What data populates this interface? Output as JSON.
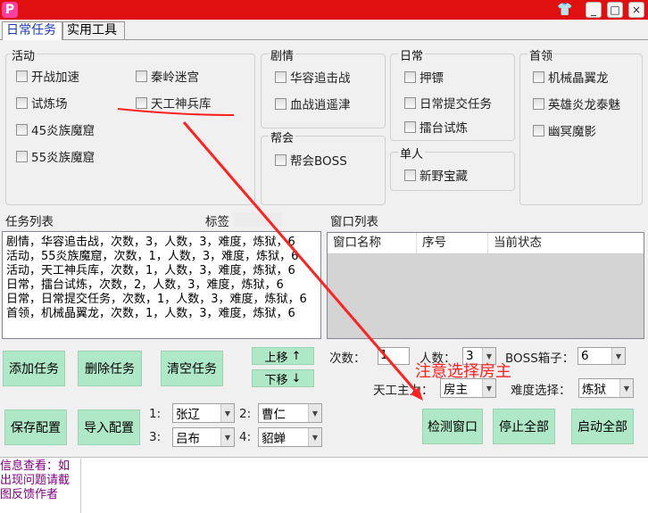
{
  "app": {
    "icon_letter": "P"
  },
  "window_controls": {
    "skin": "👕",
    "minimize": "_",
    "maximize": "□",
    "close": "×"
  },
  "tabs": [
    {
      "label": "日常任务"
    },
    {
      "label": "实用工具"
    }
  ],
  "groups": {
    "activity": {
      "title": "活动",
      "items": [
        "开战加速",
        "秦岭迷宫",
        "试炼场",
        "天工神兵库",
        "45炎族魔窟",
        "55炎族魔窟"
      ]
    },
    "story": {
      "title": "剧情",
      "items": [
        "华容追击战",
        "血战逍遥津"
      ]
    },
    "guild": {
      "title": "帮会",
      "items": [
        "帮会BOSS"
      ]
    },
    "daily": {
      "title": "日常",
      "items": [
        "押镖",
        "日常提交任务",
        "擂台试炼"
      ]
    },
    "solo": {
      "title": "单人",
      "items": [
        "新野宝藏"
      ]
    },
    "boss": {
      "title": "首领",
      "items": [
        "机械晶翼龙",
        "英雄炎龙泰魅",
        "幽冥魔影"
      ]
    }
  },
  "task_list": {
    "label": "任务列表",
    "tag_label": "标签",
    "lines": [
      "剧情，华容追击战，次数，3，人数，3，难度，炼狱，6",
      "活动，55炎族魔窟，次数，1，人数，3，难度，炼狱，6",
      "活动，天工神兵库，次数，1，人数，3，难度，炼狱，6",
      "日常，擂台试炼，次数，2，人数，3，难度，炼狱，6",
      "日常，日常提交任务，次数，1，人数，3，难度，炼狱，6",
      "首领，机械晶翼龙，次数，1，人数，3，难度，炼狱，6"
    ]
  },
  "window_list": {
    "label": "窗口列表",
    "columns": [
      "窗口名称",
      "序号",
      "当前状态"
    ]
  },
  "buttons": {
    "add_task": "添加任务",
    "delete_task": "删除任务",
    "clear_task": "清空任务",
    "move_up": "上移",
    "move_down": "下移",
    "save_config": "保存配置",
    "import_config": "导入配置",
    "detect_window": "检测窗口",
    "stop_all": "停止全部",
    "start_all": "启动全部"
  },
  "arrows": {
    "up": "↑",
    "down": "↓"
  },
  "settings": {
    "count_label": "次数：",
    "count_value": "1",
    "people_label": "人数：",
    "people_value": "3",
    "boss_box_label": "BOSS箱子：",
    "boss_box_value": "6",
    "tiangong_label": "天工主力：",
    "tiangong_value": "房主",
    "difficulty_label": "难度选择：",
    "difficulty_value": "炼狱"
  },
  "players": [
    {
      "num": "1:",
      "name": "张辽"
    },
    {
      "num": "2:",
      "name": "曹仁"
    },
    {
      "num": "3:",
      "name": "吕布"
    },
    {
      "num": "4:",
      "name": "貂蝉"
    }
  ],
  "annotation": {
    "text": "注意选择房主",
    "color": "#ff2020"
  },
  "info": {
    "text": "信息查看：如出现问题请截图反馈作者",
    "color": "#800080"
  }
}
